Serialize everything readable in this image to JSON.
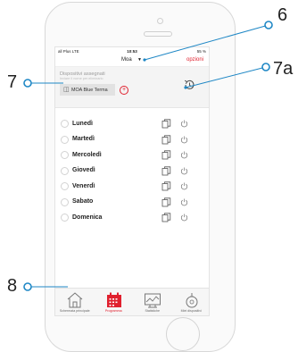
{
  "status": {
    "carrier": "all Plus LTE",
    "time": "10:53",
    "battery": "55 %"
  },
  "nav": {
    "title": "Moa",
    "options_label": "opzioni"
  },
  "assigned": {
    "title": "Dispositivi assegnati",
    "subtitle": "Inviare il nome per eliminarlo",
    "chip_label": "MOA Blue Terma",
    "add_symbol": "+"
  },
  "days": [
    {
      "label": "Lunedì"
    },
    {
      "label": "Martedì"
    },
    {
      "label": "Mercoledì"
    },
    {
      "label": "Giovedì"
    },
    {
      "label": "Venerdì"
    },
    {
      "label": "Sabato"
    },
    {
      "label": "Domenica"
    }
  ],
  "tabs": [
    {
      "label": "Schermata principale",
      "icon": "home-icon",
      "active": false
    },
    {
      "label": "Programma",
      "icon": "calendar-icon",
      "active": true
    },
    {
      "label": "Statistiche",
      "icon": "chart-icon",
      "active": false
    },
    {
      "label": "Miei dispositivi",
      "icon": "device-icon",
      "active": false
    }
  ],
  "callouts": {
    "c6": "6",
    "c7": "7",
    "c7a": "7a",
    "c8": "8"
  },
  "colors": {
    "accent": "#e0202e",
    "callout": "#1e87c5"
  }
}
